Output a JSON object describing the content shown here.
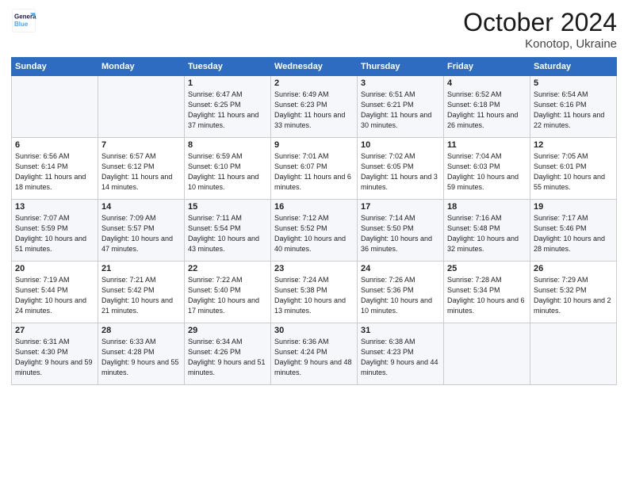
{
  "logo": {
    "line1": "General",
    "line2": "Blue"
  },
  "title": "October 2024",
  "subtitle": "Konotop, Ukraine",
  "days_of_week": [
    "Sunday",
    "Monday",
    "Tuesday",
    "Wednesday",
    "Thursday",
    "Friday",
    "Saturday"
  ],
  "weeks": [
    [
      {
        "day": "",
        "info": ""
      },
      {
        "day": "",
        "info": ""
      },
      {
        "day": "1",
        "sunrise": "6:47 AM",
        "sunset": "6:25 PM",
        "daylight": "11 hours and 37 minutes."
      },
      {
        "day": "2",
        "sunrise": "6:49 AM",
        "sunset": "6:23 PM",
        "daylight": "11 hours and 33 minutes."
      },
      {
        "day": "3",
        "sunrise": "6:51 AM",
        "sunset": "6:21 PM",
        "daylight": "11 hours and 30 minutes."
      },
      {
        "day": "4",
        "sunrise": "6:52 AM",
        "sunset": "6:18 PM",
        "daylight": "11 hours and 26 minutes."
      },
      {
        "day": "5",
        "sunrise": "6:54 AM",
        "sunset": "6:16 PM",
        "daylight": "11 hours and 22 minutes."
      }
    ],
    [
      {
        "day": "6",
        "sunrise": "6:56 AM",
        "sunset": "6:14 PM",
        "daylight": "11 hours and 18 minutes."
      },
      {
        "day": "7",
        "sunrise": "6:57 AM",
        "sunset": "6:12 PM",
        "daylight": "11 hours and 14 minutes."
      },
      {
        "day": "8",
        "sunrise": "6:59 AM",
        "sunset": "6:10 PM",
        "daylight": "11 hours and 10 minutes."
      },
      {
        "day": "9",
        "sunrise": "7:01 AM",
        "sunset": "6:07 PM",
        "daylight": "11 hours and 6 minutes."
      },
      {
        "day": "10",
        "sunrise": "7:02 AM",
        "sunset": "6:05 PM",
        "daylight": "11 hours and 3 minutes."
      },
      {
        "day": "11",
        "sunrise": "7:04 AM",
        "sunset": "6:03 PM",
        "daylight": "10 hours and 59 minutes."
      },
      {
        "day": "12",
        "sunrise": "7:05 AM",
        "sunset": "6:01 PM",
        "daylight": "10 hours and 55 minutes."
      }
    ],
    [
      {
        "day": "13",
        "sunrise": "7:07 AM",
        "sunset": "5:59 PM",
        "daylight": "10 hours and 51 minutes."
      },
      {
        "day": "14",
        "sunrise": "7:09 AM",
        "sunset": "5:57 PM",
        "daylight": "10 hours and 47 minutes."
      },
      {
        "day": "15",
        "sunrise": "7:11 AM",
        "sunset": "5:54 PM",
        "daylight": "10 hours and 43 minutes."
      },
      {
        "day": "16",
        "sunrise": "7:12 AM",
        "sunset": "5:52 PM",
        "daylight": "10 hours and 40 minutes."
      },
      {
        "day": "17",
        "sunrise": "7:14 AM",
        "sunset": "5:50 PM",
        "daylight": "10 hours and 36 minutes."
      },
      {
        "day": "18",
        "sunrise": "7:16 AM",
        "sunset": "5:48 PM",
        "daylight": "10 hours and 32 minutes."
      },
      {
        "day": "19",
        "sunrise": "7:17 AM",
        "sunset": "5:46 PM",
        "daylight": "10 hours and 28 minutes."
      }
    ],
    [
      {
        "day": "20",
        "sunrise": "7:19 AM",
        "sunset": "5:44 PM",
        "daylight": "10 hours and 24 minutes."
      },
      {
        "day": "21",
        "sunrise": "7:21 AM",
        "sunset": "5:42 PM",
        "daylight": "10 hours and 21 minutes."
      },
      {
        "day": "22",
        "sunrise": "7:22 AM",
        "sunset": "5:40 PM",
        "daylight": "10 hours and 17 minutes."
      },
      {
        "day": "23",
        "sunrise": "7:24 AM",
        "sunset": "5:38 PM",
        "daylight": "10 hours and 13 minutes."
      },
      {
        "day": "24",
        "sunrise": "7:26 AM",
        "sunset": "5:36 PM",
        "daylight": "10 hours and 10 minutes."
      },
      {
        "day": "25",
        "sunrise": "7:28 AM",
        "sunset": "5:34 PM",
        "daylight": "10 hours and 6 minutes."
      },
      {
        "day": "26",
        "sunrise": "7:29 AM",
        "sunset": "5:32 PM",
        "daylight": "10 hours and 2 minutes."
      }
    ],
    [
      {
        "day": "27",
        "sunrise": "6:31 AM",
        "sunset": "4:30 PM",
        "daylight": "9 hours and 59 minutes."
      },
      {
        "day": "28",
        "sunrise": "6:33 AM",
        "sunset": "4:28 PM",
        "daylight": "9 hours and 55 minutes."
      },
      {
        "day": "29",
        "sunrise": "6:34 AM",
        "sunset": "4:26 PM",
        "daylight": "9 hours and 51 minutes."
      },
      {
        "day": "30",
        "sunrise": "6:36 AM",
        "sunset": "4:24 PM",
        "daylight": "9 hours and 48 minutes."
      },
      {
        "day": "31",
        "sunrise": "6:38 AM",
        "sunset": "4:23 PM",
        "daylight": "9 hours and 44 minutes."
      },
      {
        "day": "",
        "info": ""
      },
      {
        "day": "",
        "info": ""
      }
    ]
  ]
}
